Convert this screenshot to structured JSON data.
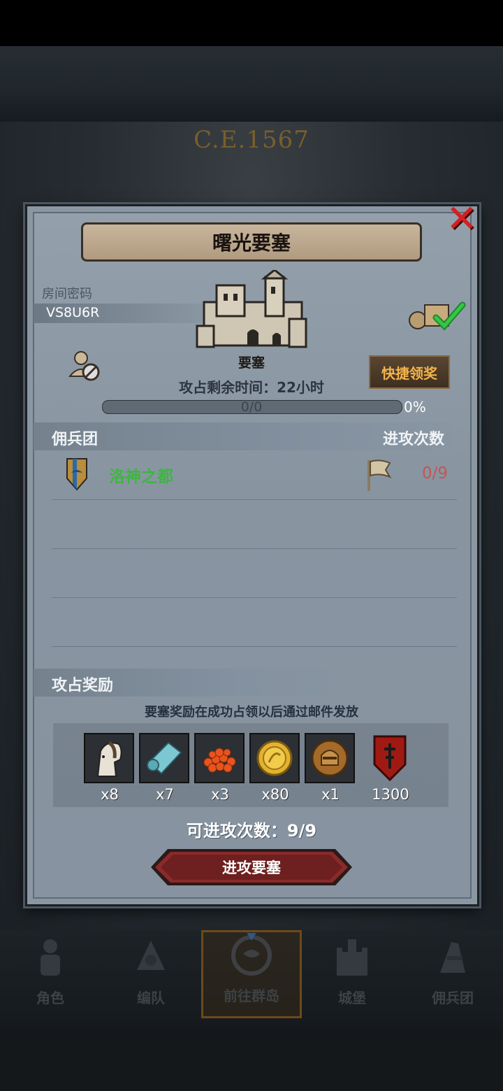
{
  "background": {
    "era": "C.E.1567"
  },
  "dialog": {
    "title": "曙光要塞",
    "close_icon": "close-icon",
    "room_password_label": "房间密码",
    "room_code": "VS8U6R",
    "fortress_label": "要塞",
    "quick_claim_label": "快捷领奖",
    "time_remaining": "攻占剩余时间：22小时",
    "progress": {
      "count": "0/0",
      "percent_text": "0%",
      "fraction": 0
    },
    "mercenary_section_title": "佣兵团",
    "attack_count_header": "进攻次数",
    "mercenaries": [
      {
        "name": "洛神之都",
        "attacks": "0/9",
        "color": "#3fb543"
      }
    ],
    "rewards_section_title": "攻占奖励",
    "reward_note": "要塞奖励在成功占领以后通过邮件发放",
    "rewards": [
      {
        "icon": "horse-icon",
        "count": "x8"
      },
      {
        "icon": "cloth-icon",
        "count": "x7"
      },
      {
        "icon": "roe-icon",
        "count": "x3"
      },
      {
        "icon": "gold-coin-icon",
        "count": "x80"
      },
      {
        "icon": "knight-medal-icon",
        "count": "x1"
      },
      {
        "icon": "banner-icon",
        "count": "1300"
      }
    ],
    "attacks_available": "可进攻次数：9/9",
    "attack_button_label": "进攻要塞"
  },
  "bottom_nav": [
    {
      "label": "角色",
      "icon": "character-icon"
    },
    {
      "label": "编队",
      "icon": "formation-icon"
    },
    {
      "label": "前往群岛",
      "icon": "islands-icon",
      "active": true
    },
    {
      "label": "城堡",
      "icon": "castle-icon"
    },
    {
      "label": "佣兵团",
      "icon": "mercenary-icon"
    }
  ],
  "colors": {
    "title_banner": "#b09b80",
    "quick_button_text": "#f4b34a",
    "attack_button": "#8a2a2a",
    "close": "#d32020"
  }
}
